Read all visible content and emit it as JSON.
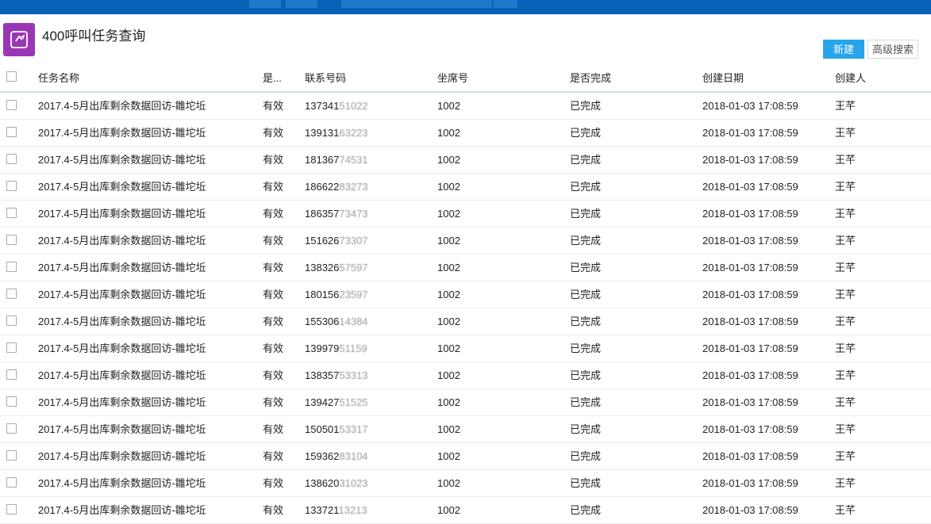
{
  "title": "400呼叫任务查询",
  "icon": "refresh-icon",
  "toolbar": {
    "new_label": "新建",
    "advanced_label": "高级搜索"
  },
  "columns": {
    "task_name": "任务名称",
    "valid": "是...",
    "phone": "联系号码",
    "seat": "坐席号",
    "done": "是否完成",
    "created_date": "创建日期",
    "creator": "创建人"
  },
  "rows": [
    {
      "name": "2017.4-5月出库剩余数据回访-雛坨坵",
      "valid": "有效",
      "phone_prefix": "137341",
      "phone_masked": "51022",
      "seat": "1002",
      "done": "已完成",
      "date": "2018-01-03 17:08:59",
      "creator": "王芊"
    },
    {
      "name": "2017.4-5月出库剩余数据回访-雛坨坵",
      "valid": "有效",
      "phone_prefix": "139131",
      "phone_masked": "63223",
      "seat": "1002",
      "done": "已完成",
      "date": "2018-01-03 17:08:59",
      "creator": "王芊"
    },
    {
      "name": "2017.4-5月出库剩余数据回访-雛坨坵",
      "valid": "有效",
      "phone_prefix": "181367",
      "phone_masked": "74531",
      "seat": "1002",
      "done": "已完成",
      "date": "2018-01-03 17:08:59",
      "creator": "王芊"
    },
    {
      "name": "2017.4-5月出库剩余数据回访-雛坨坵",
      "valid": "有效",
      "phone_prefix": "186622",
      "phone_masked": "83273",
      "seat": "1002",
      "done": "已完成",
      "date": "2018-01-03 17:08:59",
      "creator": "王芊"
    },
    {
      "name": "2017.4-5月出库剩余数据回访-雛坨坵",
      "valid": "有效",
      "phone_prefix": "186357",
      "phone_masked": "73473",
      "seat": "1002",
      "done": "已完成",
      "date": "2018-01-03 17:08:59",
      "creator": "王芊"
    },
    {
      "name": "2017.4-5月出库剩余数据回访-雛坨坵",
      "valid": "有效",
      "phone_prefix": "151626",
      "phone_masked": "73307",
      "seat": "1002",
      "done": "已完成",
      "date": "2018-01-03 17:08:59",
      "creator": "王芊"
    },
    {
      "name": "2017.4-5月出库剩余数据回访-雛坨坵",
      "valid": "有效",
      "phone_prefix": "138326",
      "phone_masked": "57597",
      "seat": "1002",
      "done": "已完成",
      "date": "2018-01-03 17:08:59",
      "creator": "王芊"
    },
    {
      "name": "2017.4-5月出库剩余数据回访-雛坨坵",
      "valid": "有效",
      "phone_prefix": "180156",
      "phone_masked": "23597",
      "seat": "1002",
      "done": "已完成",
      "date": "2018-01-03 17:08:59",
      "creator": "王芊"
    },
    {
      "name": "2017.4-5月出库剩余数据回访-雛坨坵",
      "valid": "有效",
      "phone_prefix": "155306",
      "phone_masked": "14384",
      "seat": "1002",
      "done": "已完成",
      "date": "2018-01-03 17:08:59",
      "creator": "王芊"
    },
    {
      "name": "2017.4-5月出库剩余数据回访-雛坨坵",
      "valid": "有效",
      "phone_prefix": "139979",
      "phone_masked": "51159",
      "seat": "1002",
      "done": "已完成",
      "date": "2018-01-03 17:08:59",
      "creator": "王芊"
    },
    {
      "name": "2017.4-5月出库剩余数据回访-雛坨坵",
      "valid": "有效",
      "phone_prefix": "138357",
      "phone_masked": "53313",
      "seat": "1002",
      "done": "已完成",
      "date": "2018-01-03 17:08:59",
      "creator": "王芊"
    },
    {
      "name": "2017.4-5月出库剩余数据回访-雛坨坵",
      "valid": "有效",
      "phone_prefix": "139427",
      "phone_masked": "51525",
      "seat": "1002",
      "done": "已完成",
      "date": "2018-01-03 17:08:59",
      "creator": "王芊"
    },
    {
      "name": "2017.4-5月出库剩余数据回访-雛坨坵",
      "valid": "有效",
      "phone_prefix": "150501",
      "phone_masked": "53317",
      "seat": "1002",
      "done": "已完成",
      "date": "2018-01-03 17:08:59",
      "creator": "王芊"
    },
    {
      "name": "2017.4-5月出库剩余数据回访-雛坨坵",
      "valid": "有效",
      "phone_prefix": "159362",
      "phone_masked": "83104",
      "seat": "1002",
      "done": "已完成",
      "date": "2018-01-03 17:08:59",
      "creator": "王芊"
    },
    {
      "name": "2017.4-5月出库剩余数据回访-雛坨坵",
      "valid": "有效",
      "phone_prefix": "138620",
      "phone_masked": "31023",
      "seat": "1002",
      "done": "已完成",
      "date": "2018-01-03 17:08:59",
      "creator": "王芊"
    },
    {
      "name": "2017.4-5月出库剩余数据回访-雛坨坵",
      "valid": "有效",
      "phone_prefix": "133721",
      "phone_masked": "13213",
      "seat": "1002",
      "done": "已完成",
      "date": "2018-01-03 17:08:59",
      "creator": "王芊"
    }
  ],
  "colors": {
    "topbar": "#0a62b8",
    "accent": "#27a4ea",
    "icon_bg": "#9a36b6"
  }
}
